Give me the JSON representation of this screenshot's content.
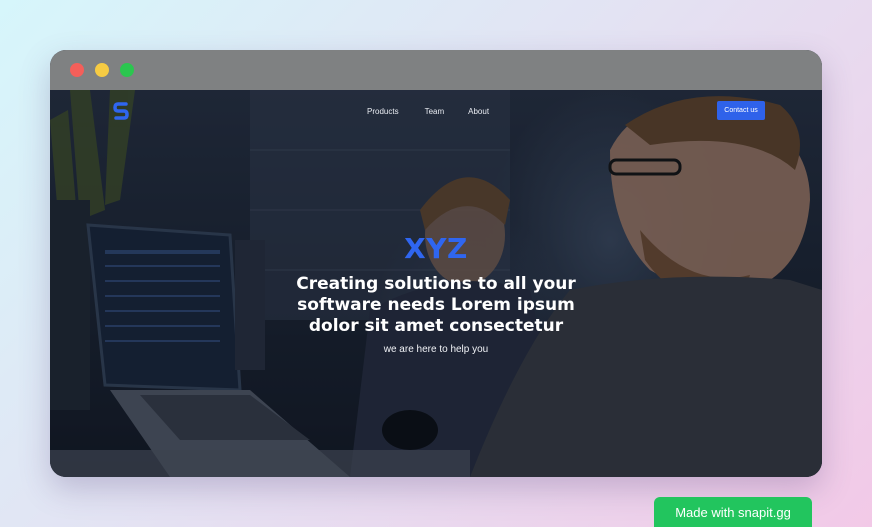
{
  "window": {
    "traffic_lights": [
      "close",
      "minimize",
      "maximize"
    ]
  },
  "nav": {
    "logo_icon": "s-logo-icon",
    "links": [
      "Products",
      "Team",
      "About"
    ],
    "cta_label": "Contact us"
  },
  "hero": {
    "brand": "XYZ",
    "headline": "Creating solutions to all your software needs Lorem ipsum dolor sit amet consectetur",
    "subline": "we are here to help you",
    "background_image": "office-developers-photo"
  },
  "badge": {
    "label": "Made with snapit.gg"
  },
  "colors": {
    "accent": "#2f62ea",
    "brand_text": "#2f66f0",
    "badge_bg": "#22c55e"
  }
}
